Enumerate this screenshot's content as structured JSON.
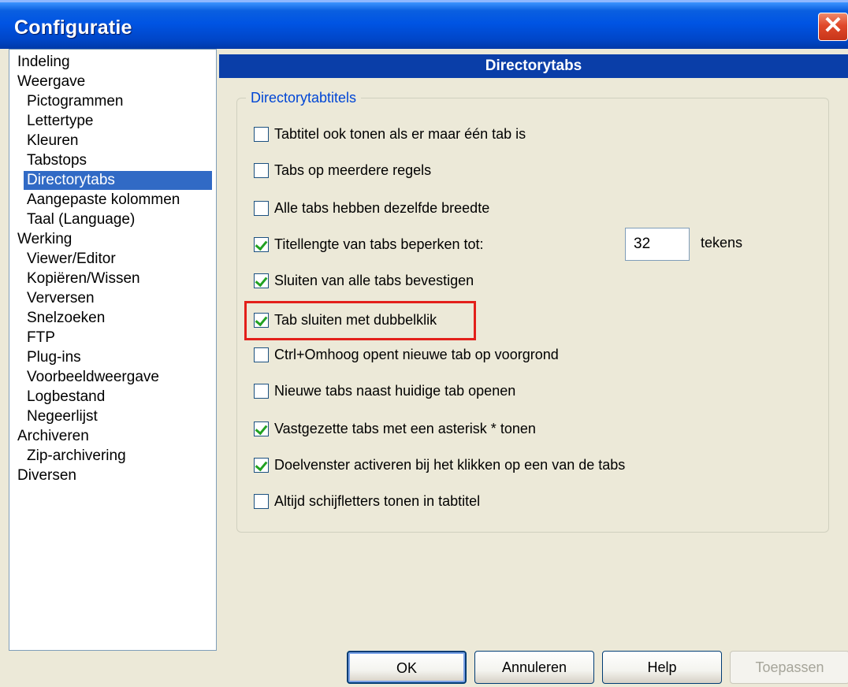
{
  "window": {
    "title": "Configuratie",
    "close_glyph": "✕"
  },
  "tree": [
    "Indeling",
    "Weergave",
    "Pictogrammen",
    "Lettertype",
    "Kleuren",
    "Tabstops",
    "Directorytabs",
    "Aangepaste kolommen",
    "Taal (Language)",
    "Werking",
    "Viewer/Editor",
    "Kopiëren/Wissen",
    "Verversen",
    "Snelzoeken",
    "FTP",
    "Plug-ins",
    "Voorbeeldweergave",
    "Logbestand",
    "Negeerlijst",
    "Archiveren",
    "Zip-archivering",
    "Diversen"
  ],
  "tree_selected": "Directorytabs",
  "panel": {
    "title": "Directorytabs"
  },
  "group": {
    "label": "Directorytabtitels"
  },
  "options": [
    {
      "label": "Tabtitel ook tonen als er maar één tab is",
      "checked": false
    },
    {
      "label": "Tabs op meerdere regels",
      "checked": false
    },
    {
      "label": "Alle tabs hebben dezelfde breedte",
      "checked": false
    },
    {
      "label": "Titellengte van tabs beperken tot:",
      "checked": true
    },
    {
      "label": "Sluiten van alle tabs bevestigen",
      "checked": true
    },
    {
      "label": "Tab sluiten met dubbelklik",
      "checked": true
    },
    {
      "label": "Ctrl+Omhoog opent nieuwe tab op voorgrond",
      "checked": false
    },
    {
      "label": "Nieuwe tabs naast huidige tab openen",
      "checked": false
    },
    {
      "label": "Vastgezette tabs met een asterisk * tonen",
      "checked": true
    },
    {
      "label": "Doelvenster activeren bij het klikken op een van de tabs",
      "checked": true
    },
    {
      "label": "Altijd schijfletters tonen in tabtitel",
      "checked": false
    }
  ],
  "title_length": {
    "value": "32",
    "unit": "tekens"
  },
  "buttons": {
    "ok": "OK",
    "cancel": "Annuleren",
    "help": "Help",
    "apply": "Toepassen"
  }
}
